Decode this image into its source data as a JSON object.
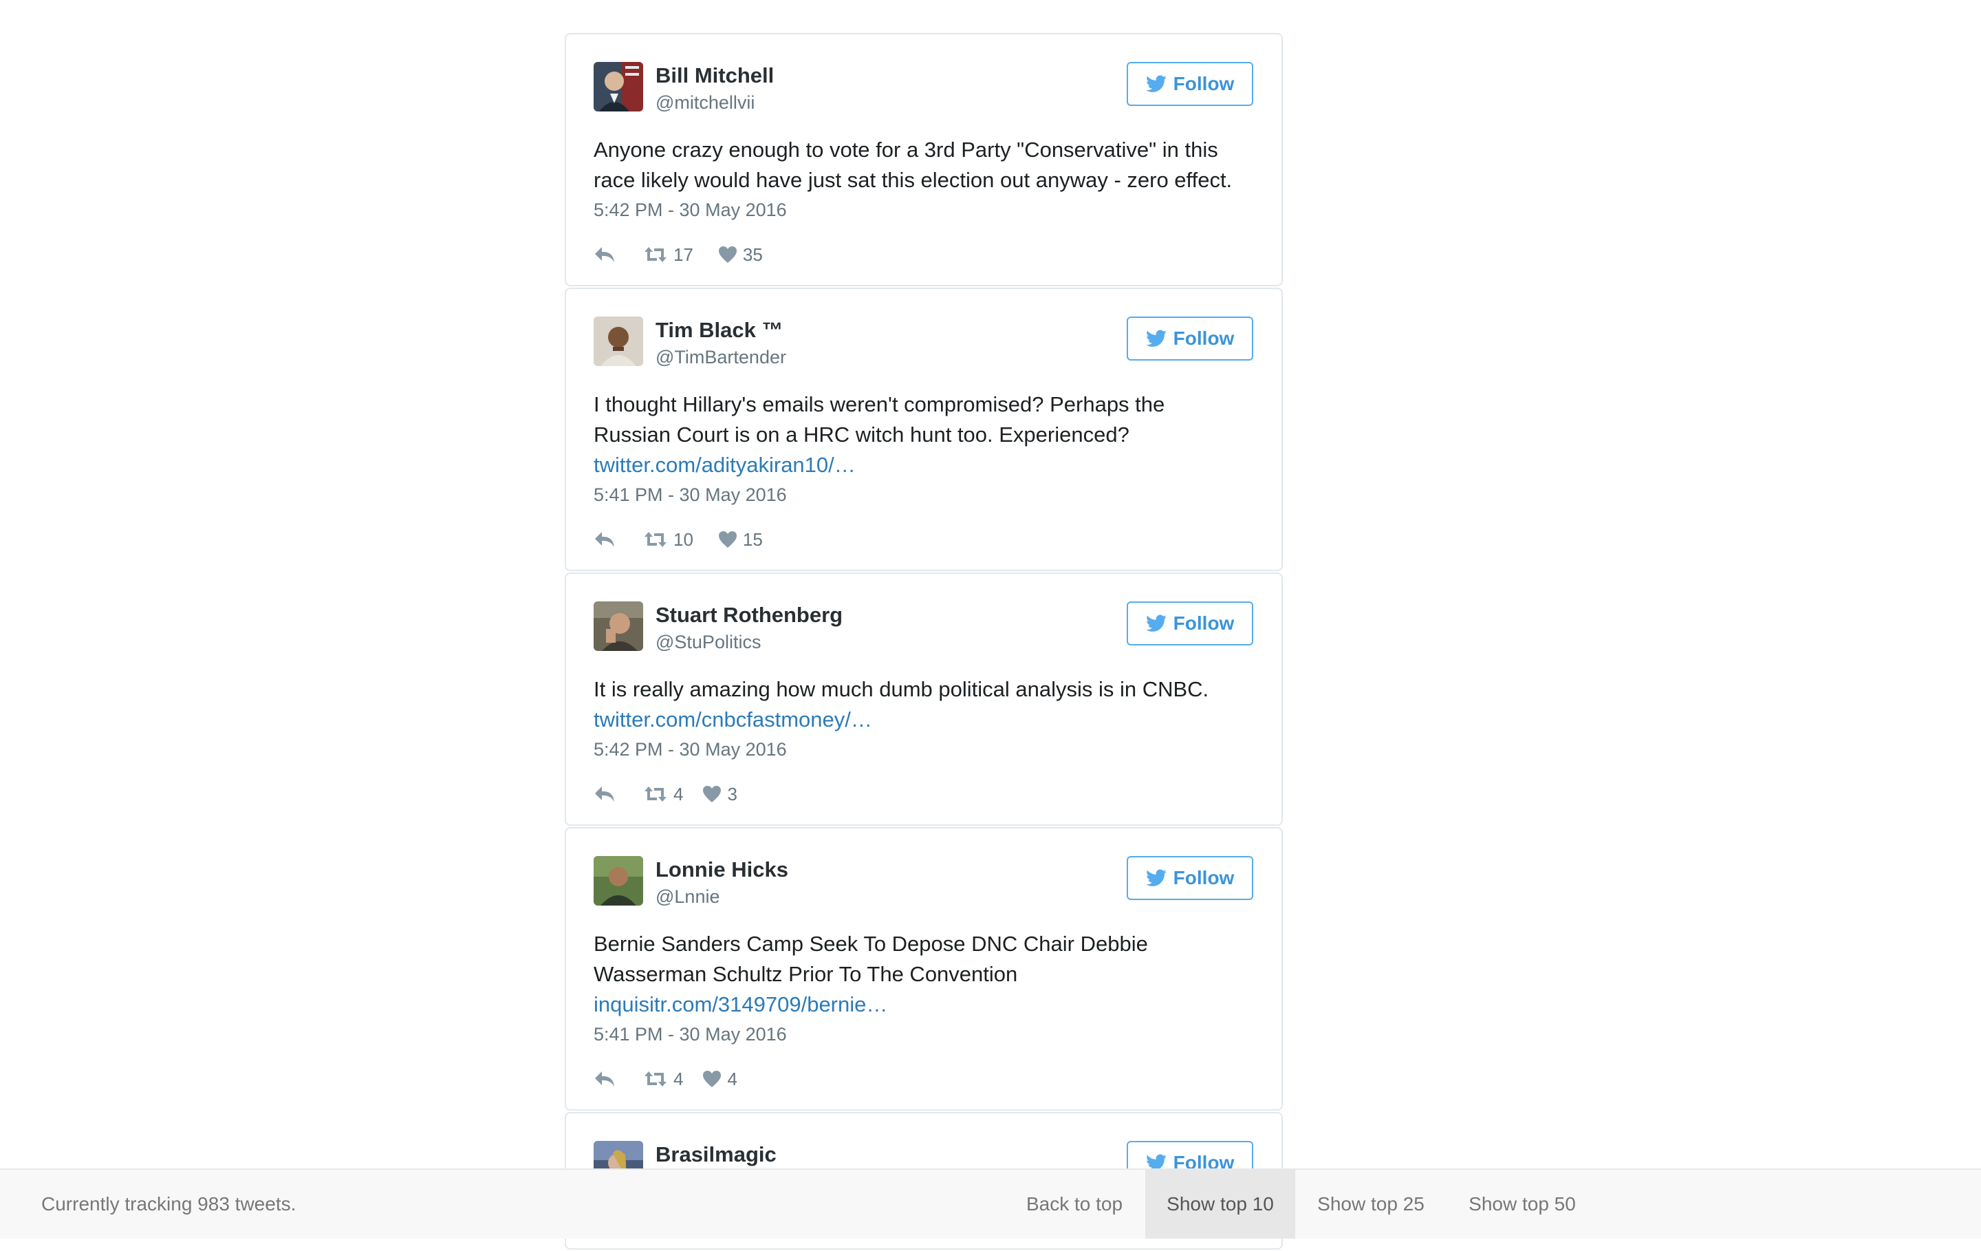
{
  "tweets": [
    {
      "name": "Bill Mitchell",
      "handle": "@mitchellvii",
      "text_lines": [
        "Anyone crazy enough to vote for a 3rd Party \"Conservative\" in this",
        "race likely would have just sat this election out anyway - zero effect."
      ],
      "link": "",
      "timestamp": "5:42 PM - 30 May 2016",
      "retweets": "17",
      "likes": "35",
      "follow_label": "Follow"
    },
    {
      "name": "Tim Black ™",
      "handle": "@TimBartender",
      "text_lines": [
        "I thought Hillary's emails weren't compromised? Perhaps the",
        "Russian Court is on a HRC witch hunt too. Experienced?"
      ],
      "link": "twitter.com/adityakiran10/…",
      "timestamp": "5:41 PM - 30 May 2016",
      "retweets": "10",
      "likes": "15",
      "follow_label": "Follow"
    },
    {
      "name": "Stuart Rothenberg",
      "handle": "@StuPolitics",
      "text_lines": [
        "It is really amazing how much dumb political analysis is in CNBC."
      ],
      "link": "twitter.com/cnbcfastmoney/…",
      "timestamp": "5:42 PM - 30 May 2016",
      "retweets": "4",
      "likes": "3",
      "follow_label": "Follow"
    },
    {
      "name": "Lonnie Hicks",
      "handle": "@Lnnie",
      "text_lines": [
        "Bernie Sanders Camp Seek To Depose DNC Chair Debbie",
        "Wasserman Schultz Prior To The Convention"
      ],
      "link": "inquisitr.com/3149709/bernie…",
      "timestamp": "5:41 PM - 30 May 2016",
      "retweets": "4",
      "likes": "4",
      "follow_label": "Follow"
    },
    {
      "name": "Brasilmagic",
      "handle": "",
      "text_lines": [],
      "link": "",
      "timestamp": "",
      "retweets": "",
      "likes": "",
      "follow_label": "Follow"
    }
  ],
  "footer": {
    "tracking_text": "Currently tracking 983 tweets.",
    "nav": [
      {
        "label": "Back to top",
        "active": false
      },
      {
        "label": "Show top 10",
        "active": true
      },
      {
        "label": "Show top 25",
        "active": false
      },
      {
        "label": "Show top 50",
        "active": false
      }
    ]
  },
  "colors": {
    "twitter_blue": "#55acee",
    "link_blue": "#2b7bb9",
    "muted_text": "#66757f",
    "card_border": "#e1e8ed",
    "footer_bg": "#f8f8f8",
    "active_nav_bg": "#e7e7e7"
  },
  "icons": {
    "follow": "twitter-bird-icon",
    "reply": "reply-icon",
    "retweet": "retweet-icon",
    "like": "heart-icon"
  }
}
